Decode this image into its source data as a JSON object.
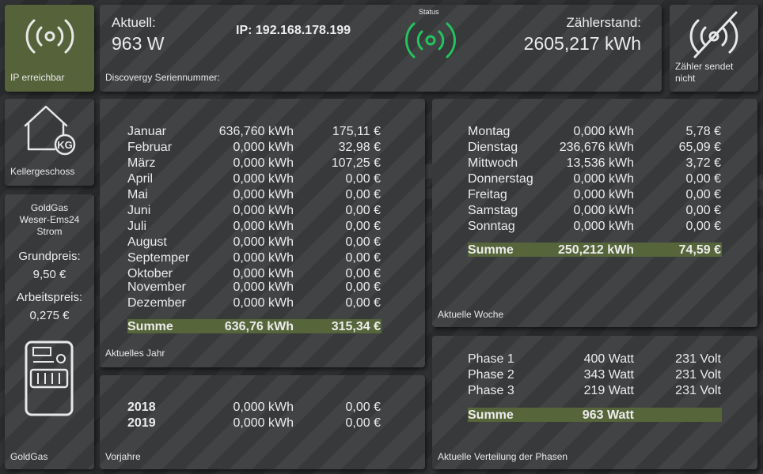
{
  "colors": {
    "olive": "#56633a",
    "sum_bar": "#56653a",
    "status_green": "#22c55e",
    "tile": "#3a3c3e"
  },
  "ip_tile": {
    "icon": "wifi-signal-icon",
    "label": "IP erreichbar"
  },
  "header": {
    "aktuell_label": "Aktuell:",
    "aktuell_value": "963 W",
    "ip": "IP: 192.168.178.199",
    "status_label": "Status",
    "status_icon": "wifi-signal-icon",
    "zaehlerstand_label": "Zählerstand:",
    "zaehlerstand_value": "2605,217 kWh",
    "serial_label": "Discovergy Seriennummer:"
  },
  "zaehler_tile": {
    "icon": "signal-off-icon",
    "label": "Zähler sendet nicht"
  },
  "keller_tile": {
    "icon": "house-kg-icon",
    "icon_text": "KG",
    "label": "Kellergeschoss"
  },
  "goldgas": {
    "provider": "GoldGas",
    "tariff": "Weser-Ems24",
    "type": "Strom",
    "grundpreis_label": "Grundpreis:",
    "grundpreis_value": "9,50 €",
    "arbeitspreis_label": "Arbeitspreis:",
    "arbeitspreis_value": "0,275 €",
    "icon": "electric-meter-icon",
    "label": "GoldGas"
  },
  "year": {
    "months": [
      {
        "name": "Januar",
        "kwh": "636,760 kWh",
        "eur": "175,11 €"
      },
      {
        "name": "Februar",
        "kwh": "0,000 kWh",
        "eur": "32,98 €"
      },
      {
        "name": "März",
        "kwh": "0,000 kWh",
        "eur": "107,25 €"
      },
      {
        "name": "April",
        "kwh": "0,000 kWh",
        "eur": "0,00 €"
      },
      {
        "name": "Mai",
        "kwh": "0,000 kWh",
        "eur": "0,00 €"
      },
      {
        "name": "Juni",
        "kwh": "0,000 kWh",
        "eur": "0,00 €"
      },
      {
        "name": "Juli",
        "kwh": "0,000 kWh",
        "eur": "0,00 €"
      },
      {
        "name": "August",
        "kwh": "0,000 kWh",
        "eur": "0,00 €"
      },
      {
        "name": "Septemper",
        "kwh": "0,000 kWh",
        "eur": "0,00 €"
      },
      {
        "name": "Oktober",
        "kwh": "0,000 kWh",
        "eur": "0,00 €"
      },
      {
        "name": "November",
        "kwh": "0,000 kWh",
        "eur": "0,00 €"
      },
      {
        "name": "Dezember",
        "kwh": "0,000 kWh",
        "eur": "0,00 €"
      }
    ],
    "sum": {
      "name": "Summe",
      "kwh": "636,76 kWh",
      "eur": "315,34 €"
    },
    "label": "Aktuelles Jahr"
  },
  "prev_years": {
    "rows": [
      {
        "year": "2018",
        "kwh": "0,000 kWh",
        "eur": "0,00 €"
      },
      {
        "year": "2019",
        "kwh": "0,000 kWh",
        "eur": "0,00 €"
      }
    ],
    "label": "Vorjahre"
  },
  "week": {
    "days": [
      {
        "name": "Montag",
        "kwh": "0,000 kWh",
        "eur": "5,78 €"
      },
      {
        "name": "Dienstag",
        "kwh": "236,676 kWh",
        "eur": "65,09 €"
      },
      {
        "name": "Mittwoch",
        "kwh": "13,536 kWh",
        "eur": "3,72 €"
      },
      {
        "name": "Donnerstag",
        "kwh": "0,000 kWh",
        "eur": "0,00 €"
      },
      {
        "name": "Freitag",
        "kwh": "0,000 kWh",
        "eur": "0,00 €"
      },
      {
        "name": "Samstag",
        "kwh": "0,000 kWh",
        "eur": "0,00 €"
      },
      {
        "name": "Sonntag",
        "kwh": "0,000 kWh",
        "eur": "0,00 €"
      }
    ],
    "sum": {
      "name": "Summe",
      "kwh": "250,212 kWh",
      "eur": "74,59 €"
    },
    "label": "Aktuelle Woche"
  },
  "phases": {
    "rows": [
      {
        "name": "Phase 1",
        "watt": "400 Watt",
        "volt": "231 Volt"
      },
      {
        "name": "Phase 2",
        "watt": "343 Watt",
        "volt": "231 Volt"
      },
      {
        "name": "Phase 3",
        "watt": "219 Watt",
        "volt": "231 Volt"
      }
    ],
    "sum": {
      "name": "Summe",
      "watt": "963 Watt"
    },
    "label": "Aktuelle Verteilung der Phasen"
  }
}
